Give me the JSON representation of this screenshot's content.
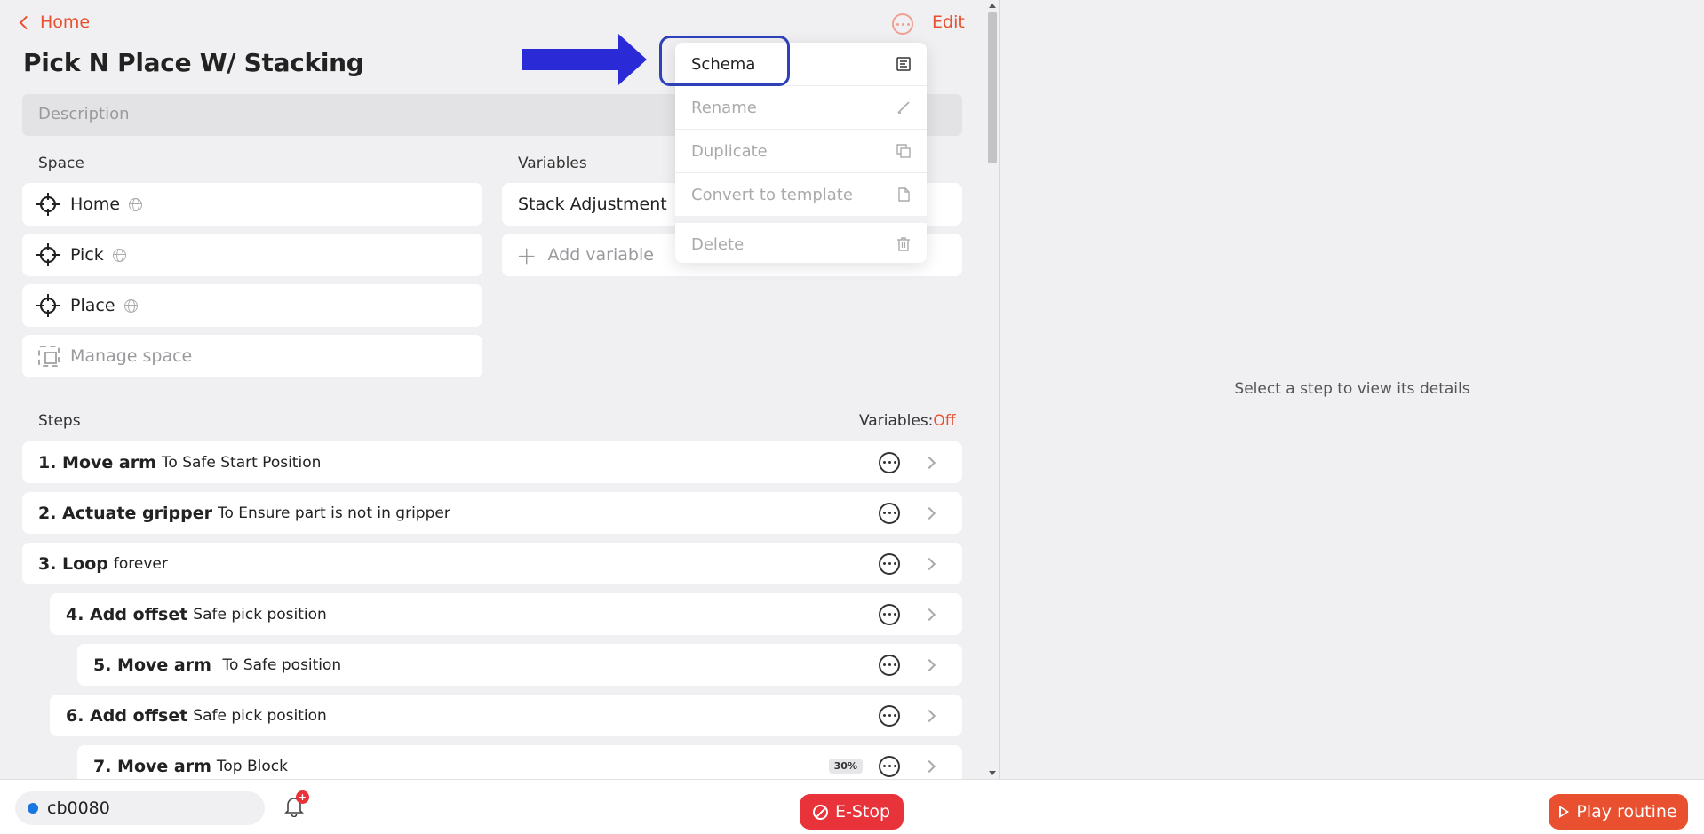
{
  "header": {
    "back_label": "Home",
    "title": "Pick N Place W/ Stacking",
    "edit_label": "Edit"
  },
  "description": {
    "placeholder": "Description"
  },
  "space": {
    "label": "Space",
    "items": [
      {
        "label": "Home"
      },
      {
        "label": "Pick"
      },
      {
        "label": "Place"
      }
    ],
    "manage_label": "Manage space"
  },
  "variables": {
    "label": "Variables",
    "items": [
      {
        "label": "Stack Adjustment"
      }
    ],
    "add_label": "Add variable"
  },
  "steps": {
    "label": "Steps",
    "variables_toggle_label": "Variables:",
    "variables_toggle_value": "Off",
    "items": [
      {
        "num": "1. Move arm",
        "sub": "To Safe Start Position",
        "level": 0
      },
      {
        "num": "2. Actuate gripper",
        "sub": "To Ensure part is not in gripper",
        "level": 0
      },
      {
        "num": "3. Loop",
        "sub": "forever",
        "level": 0
      },
      {
        "num": "4. Add offset",
        "sub": "Safe pick position",
        "level": 1
      },
      {
        "num": "5. Move arm ",
        "sub": "To Safe position",
        "level": 2
      },
      {
        "num": "6. Add offset",
        "sub": "Safe pick position",
        "level": 1
      },
      {
        "num": "7. Move arm",
        "sub": "Top Block",
        "level": 2,
        "badge": "30%"
      }
    ]
  },
  "context_menu": {
    "items": [
      {
        "label": "Schema",
        "icon": "schema-icon",
        "enabled": true
      },
      {
        "label": "Rename",
        "icon": "pencil-icon",
        "enabled": false
      },
      {
        "label": "Duplicate",
        "icon": "copy-icon",
        "enabled": false
      },
      {
        "label": "Convert to template",
        "icon": "file-icon",
        "enabled": false
      },
      {
        "label": "Delete",
        "icon": "trash-icon",
        "enabled": false
      }
    ]
  },
  "detail_panel": {
    "empty_text": "Select a step to view its details"
  },
  "bottom_bar": {
    "robot_name": "cb0080",
    "robot_status_color": "#1976e0",
    "notification_count": "+",
    "estop_label": "E-Stop",
    "play_label": "Play routine"
  },
  "colors": {
    "accent": "#e8502f",
    "danger": "#e8333a",
    "annotation": "#2a2ad6"
  }
}
